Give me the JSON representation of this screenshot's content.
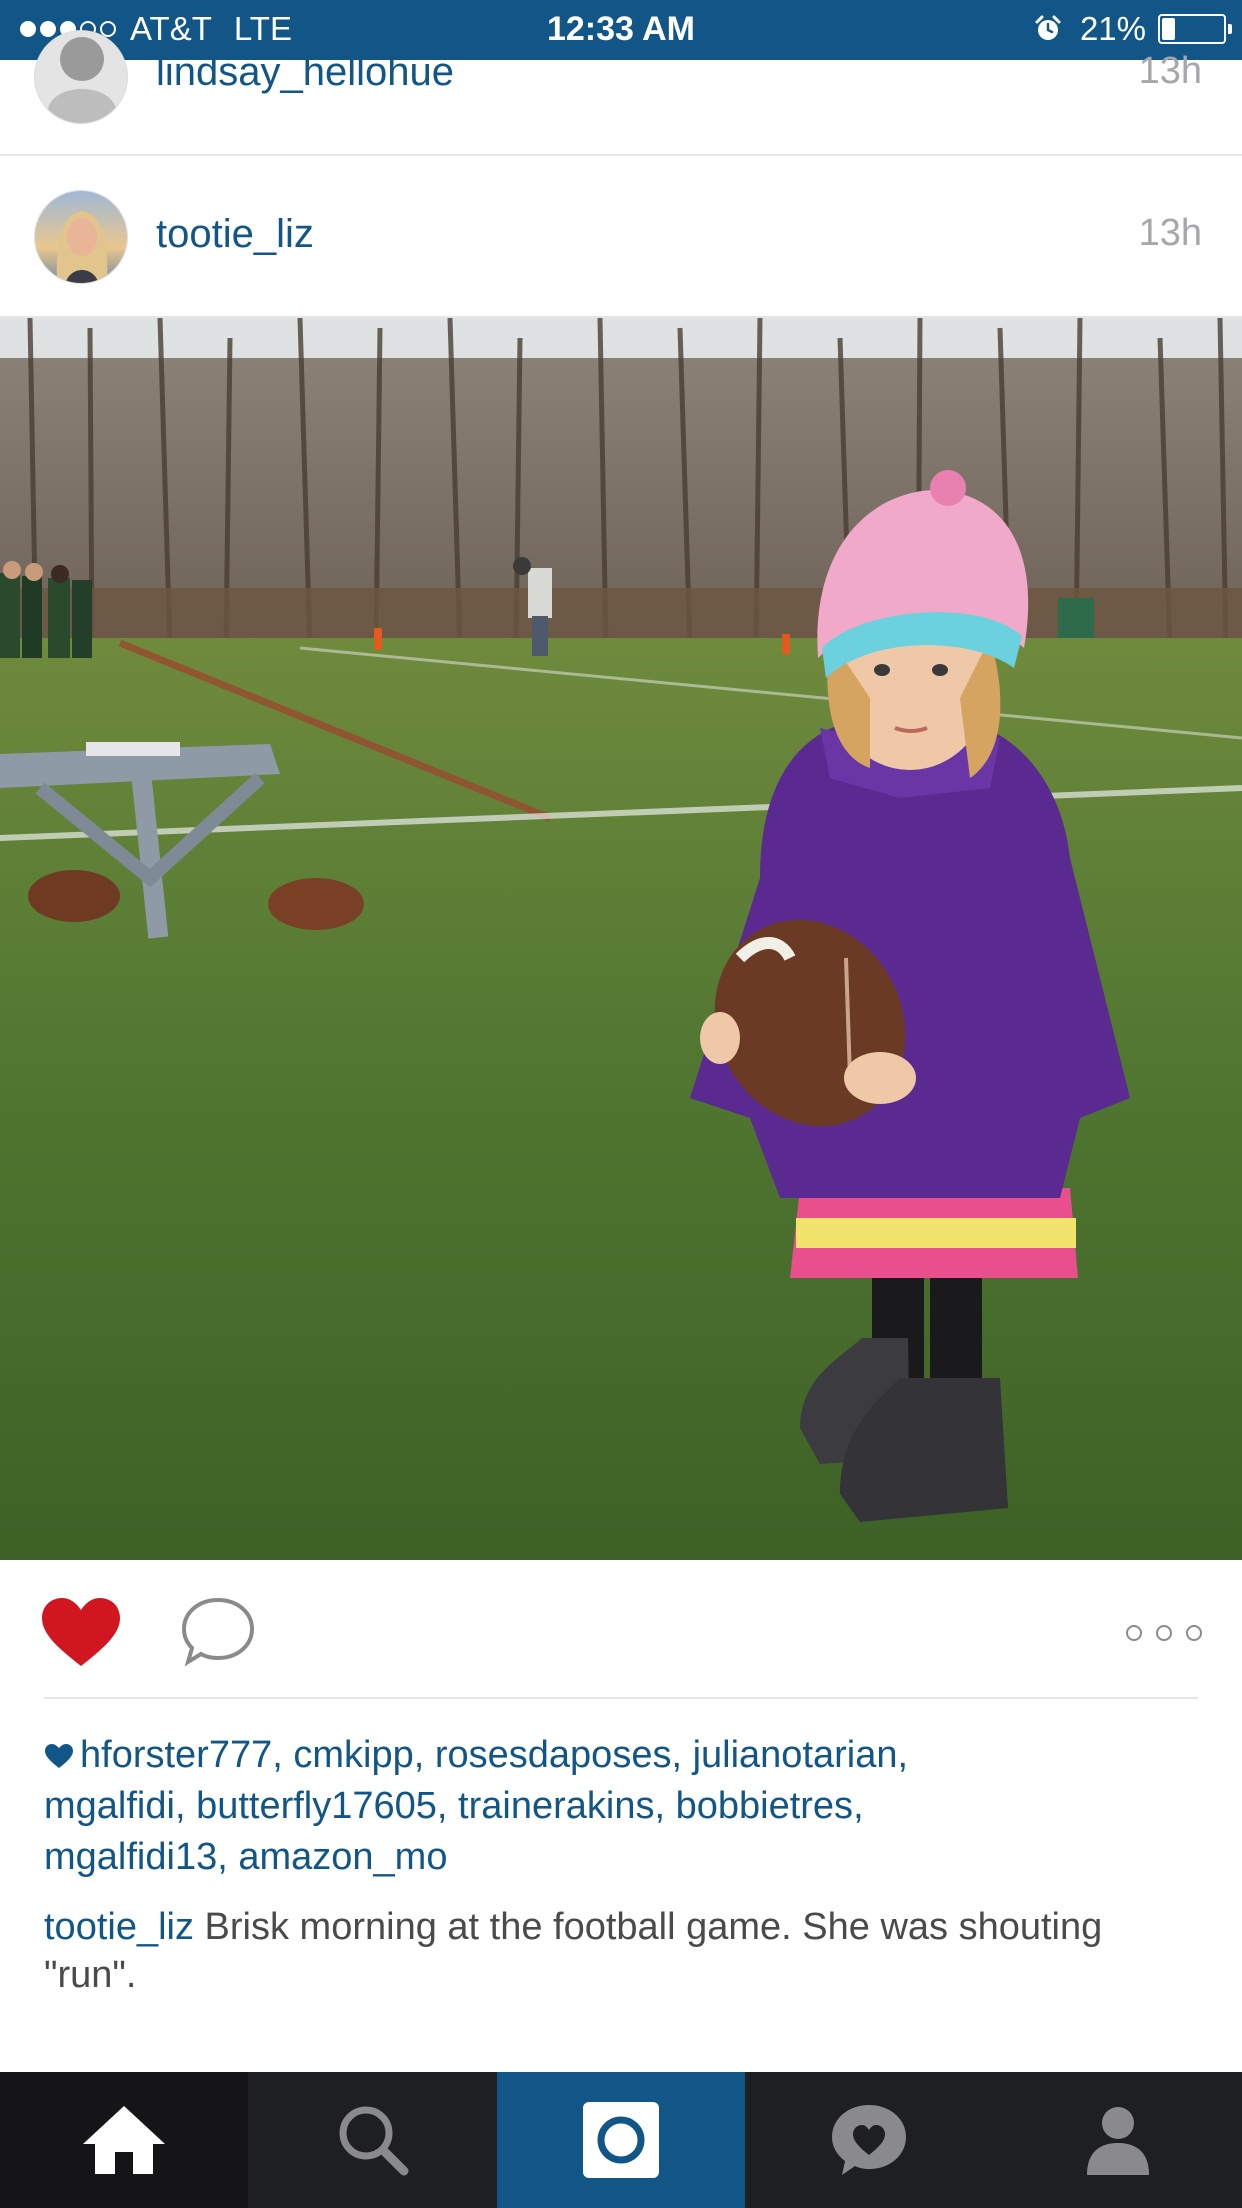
{
  "status_bar": {
    "signal_dots_filled": 3,
    "signal_dots_total": 5,
    "carrier": "AT&T",
    "network": "LTE",
    "time": "12:33 AM",
    "battery_percent": "21%",
    "battery_level": 0.21
  },
  "feed": {
    "previous_post": {
      "username": "lindsay_hellohue",
      "time": "13h"
    },
    "post": {
      "username": "tootie_liz",
      "time": "13h",
      "liked": true,
      "likers": [
        "hforster777",
        "cmkipp",
        "rosesdaposes",
        "julianotarian",
        "mgalfidi",
        "butterfly17605",
        "trainerakins",
        "bobbietres",
        "mgalfidi13",
        "amazon_mo"
      ],
      "caption_user": "tootie_liz",
      "caption_text": "Brisk morning at the football game. She was shouting \"run\"."
    }
  },
  "tab_bar": {
    "items": [
      {
        "icon": "home-icon",
        "active": true
      },
      {
        "icon": "search-icon",
        "active": false
      },
      {
        "icon": "camera-icon",
        "active": false
      },
      {
        "icon": "activity-heart-icon",
        "active": false
      },
      {
        "icon": "profile-icon",
        "active": false
      }
    ]
  },
  "colors": {
    "brand_blue": "#125688",
    "like_red": "#d0171f",
    "tab_bar_bg": "#1e1f23"
  }
}
